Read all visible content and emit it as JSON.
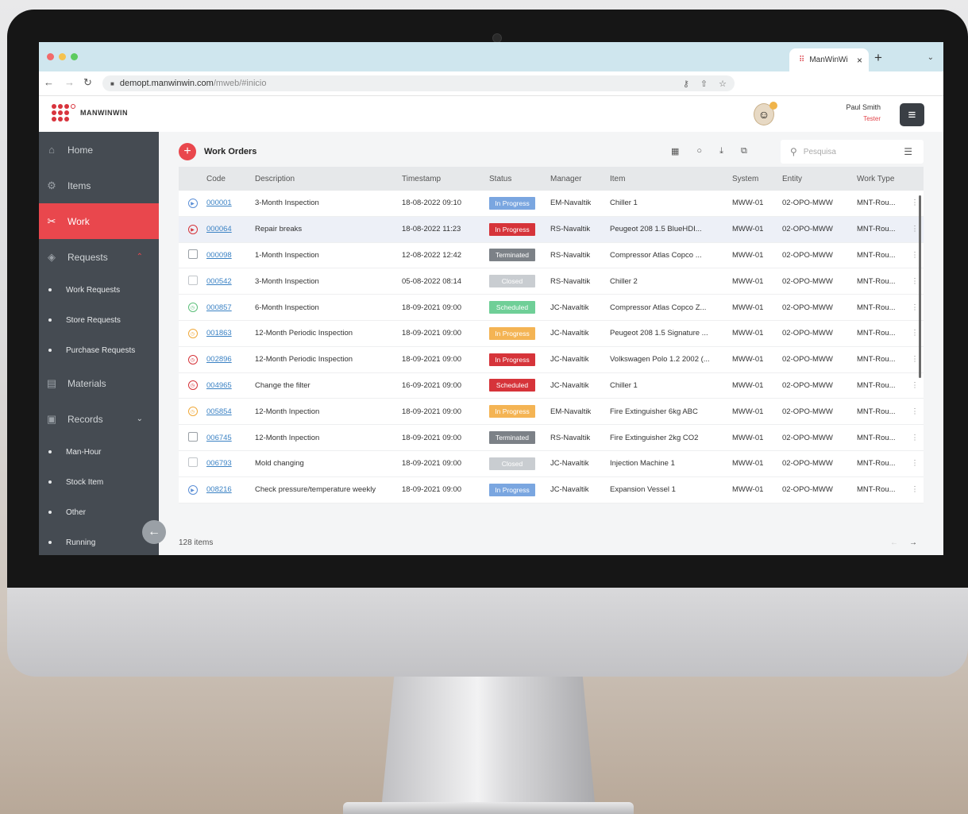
{
  "browser": {
    "tab_title": "ManWinWi",
    "tab_close": "×",
    "new_tab": "+",
    "tab_menu": "⌄",
    "url_host": "demopt.manwinwin.com",
    "url_path": "/mweb/#inicio"
  },
  "app": {
    "logo_text": "MANWINWIN",
    "user_name": "Paul Smith",
    "user_role": "Tester",
    "menu_icon": "≡"
  },
  "sidebar": {
    "home": "Home",
    "items": "Items",
    "work": "Work",
    "requests": "Requests",
    "requests_sub": [
      "Work Requests",
      "Store Requests",
      "Purchase Requests"
    ],
    "materials": "Materials",
    "records": "Records",
    "records_sub": [
      "Man-Hour",
      "Stock Item",
      "Other",
      "Running"
    ]
  },
  "toolbar": {
    "title": "Work Orders",
    "search_placeholder": "Pesquisa"
  },
  "table": {
    "headers": [
      "Code",
      "Description",
      "Timestamp",
      "Status",
      "Manager",
      "Item",
      "System",
      "Entity",
      "Work Type"
    ],
    "rows": [
      {
        "code": "000001",
        "desc": "3-Month Inspection",
        "ts": "18-08-2022 09:10",
        "status": "In Progress",
        "manager": "EM-Navaltik",
        "item": "Chiller 1",
        "system": "MWW-01",
        "entity": "02-OPO-MWW",
        "worktype": "MNT-Rou..."
      },
      {
        "code": "000064",
        "desc": "Repair breaks",
        "ts": "18-08-2022 11:23",
        "status": "In Progress",
        "manager": "RS-Navaltik",
        "item": "Peugeot 208 1.5 BlueHDI...",
        "system": "MWW-01",
        "entity": "02-OPO-MWW",
        "worktype": "MNT-Rou..."
      },
      {
        "code": "000098",
        "desc": "1-Month Inspection",
        "ts": "12-08-2022 12:42",
        "status": "Terminated",
        "manager": "RS-Navaltik",
        "item": "Compressor Atlas Copco ...",
        "system": "MWW-01",
        "entity": "02-OPO-MWW",
        "worktype": "MNT-Rou..."
      },
      {
        "code": "000542",
        "desc": "3-Month Inspection",
        "ts": "05-08-2022 08:14",
        "status": "Closed",
        "manager": "RS-Navaltik",
        "item": "Chiller 2",
        "system": "MWW-01",
        "entity": "02-OPO-MWW",
        "worktype": "MNT-Rou..."
      },
      {
        "code": "000857",
        "desc": "6-Month Inspection",
        "ts": "18-09-2021 09:00",
        "status": "Scheduled",
        "manager": "JC-Navaltik",
        "item": "Compressor Atlas Copco Z...",
        "system": "MWW-01",
        "entity": "02-OPO-MWW",
        "worktype": "MNT-Rou..."
      },
      {
        "code": "001863",
        "desc": "12-Month Periodic Inspection",
        "ts": "18-09-2021 09:00",
        "status": "In Progress",
        "manager": "JC-Navaltik",
        "item": "Peugeot 208 1.5 Signature ...",
        "system": "MWW-01",
        "entity": "02-OPO-MWW",
        "worktype": "MNT-Rou..."
      },
      {
        "code": "002896",
        "desc": "12-Month Periodic Inspection",
        "ts": "18-09-2021 09:00",
        "status": "In Progress",
        "manager": "JC-Navaltik",
        "item": "Volkswagen Polo 1.2 2002 (...",
        "system": "MWW-01",
        "entity": "02-OPO-MWW",
        "worktype": "MNT-Rou..."
      },
      {
        "code": "004965",
        "desc": "Change the filter",
        "ts": "16-09-2021 09:00",
        "status": "Scheduled",
        "manager": "JC-Navaltik",
        "item": "Chiller 1",
        "system": "MWW-01",
        "entity": "02-OPO-MWW",
        "worktype": "MNT-Rou..."
      },
      {
        "code": "005854",
        "desc": "12-Month Inpection",
        "ts": "18-09-2021 09:00",
        "status": "In Progress",
        "manager": "EM-Navaltik",
        "item": "Fire Extinguisher 6kg ABC",
        "system": "MWW-01",
        "entity": "02-OPO-MWW",
        "worktype": "MNT-Rou..."
      },
      {
        "code": "006745",
        "desc": "12-Month Inpection",
        "ts": "18-09-2021 09:00",
        "status": "Terminated",
        "manager": "RS-Navaltik",
        "item": "Fire Extinguisher 2kg CO2",
        "system": "MWW-01",
        "entity": "02-OPO-MWW",
        "worktype": "MNT-Rou..."
      },
      {
        "code": "006793",
        "desc": "Mold changing",
        "ts": "18-09-2021 09:00",
        "status": "Closed",
        "manager": "JC-Navaltik",
        "item": "Injection Machine 1",
        "system": "MWW-01",
        "entity": "02-OPO-MWW",
        "worktype": "MNT-Rou..."
      },
      {
        "code": "008216",
        "desc": "Check pressure/temperature weekly",
        "ts": "18-09-2021 09:00",
        "status": "In Progress",
        "manager": "JC-Navaltik",
        "item": "Expansion Vessel 1",
        "system": "MWW-01",
        "entity": "02-OPO-MWW",
        "worktype": "MNT-Rou..."
      }
    ],
    "row_icons": [
      {
        "name": "play-icon",
        "glyph": "▶",
        "color": "#5b8fd6",
        "box": false
      },
      {
        "name": "play-icon",
        "glyph": "▶",
        "color": "#d6343a",
        "box": false
      },
      {
        "name": "archive-icon",
        "glyph": "",
        "color": "#9aa0a6",
        "box": true
      },
      {
        "name": "archive-icon",
        "glyph": "",
        "color": "#c2c6ca",
        "box": true
      },
      {
        "name": "clock-icon",
        "glyph": "◷",
        "color": "#5cbf7a",
        "box": false
      },
      {
        "name": "clock-icon",
        "glyph": "◷",
        "color": "#f0a93a",
        "box": false
      },
      {
        "name": "clock-icon",
        "glyph": "◷",
        "color": "#d6343a",
        "box": false
      },
      {
        "name": "clock-icon",
        "glyph": "◷",
        "color": "#d6343a",
        "box": false
      },
      {
        "name": "clock-icon",
        "glyph": "◷",
        "color": "#f0a93a",
        "box": false
      },
      {
        "name": "archive-icon",
        "glyph": "",
        "color": "#9aa0a6",
        "box": true
      },
      {
        "name": "archive-icon",
        "glyph": "",
        "color": "#c2c6ca",
        "box": true
      },
      {
        "name": "play-icon",
        "glyph": "▶",
        "color": "#5b8fd6",
        "box": false
      }
    ],
    "status_colors": [
      "#7aa6e0",
      "#d6343a",
      "#7c8187",
      "#c9cdd1",
      "#6fcf97",
      "#f4b454",
      "#d6343a",
      "#d6343a",
      "#f4b454",
      "#7c8187",
      "#c9cdd1",
      "#7aa6e0"
    ],
    "selected_row": 1,
    "row_menu": "⋮"
  },
  "footer": {
    "count": "128 items"
  },
  "colors": {
    "accent": "#e9474d",
    "sidebar_bg": "#454b52"
  }
}
